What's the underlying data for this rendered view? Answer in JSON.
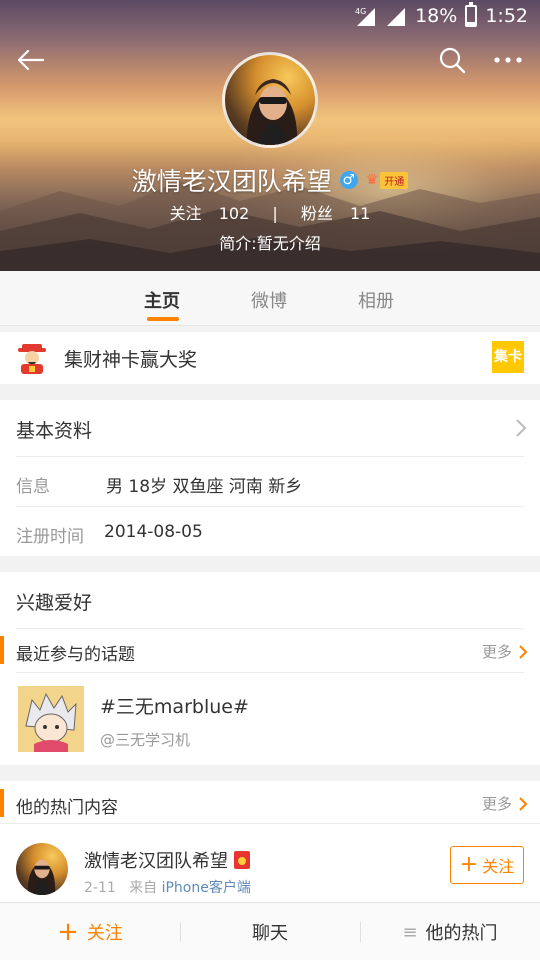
{
  "status_bar": {
    "network": "4G",
    "battery_percent": "18%",
    "battery_level": 0.18,
    "time": "1:52"
  },
  "header": {
    "back_icon": "arrow-left-icon",
    "search_icon": "search-icon",
    "more_icon": "more-horizontal-icon",
    "name": "激情老汉团队希望",
    "gender_symbol": "♂",
    "vip_label": "开通",
    "following_label": "关注",
    "following_count": "102",
    "separator": "|",
    "followers_label": "粉丝",
    "followers_count": "11",
    "bio": "简介:暂无介绍"
  },
  "tabs": [
    {
      "label": "主页",
      "active": true
    },
    {
      "label": "微博",
      "active": false
    },
    {
      "label": "相册",
      "active": false
    }
  ],
  "treasure": {
    "title": "集财神卡赢大奖",
    "badge": "集卡"
  },
  "basic_info": {
    "title": "基本资料",
    "info_label": "信息",
    "info_value": "男 18岁 双鱼座 河南 新乡",
    "reg_label": "注册时间",
    "reg_value": "2014-08-05"
  },
  "interests": {
    "title": "兴趣爱好",
    "recent_topics_title": "最近参与的话题",
    "more": "更多",
    "topic_title": "#三无marblue#",
    "topic_sub": "@三无学习机"
  },
  "hot": {
    "title": "他的热门内容",
    "more": "更多",
    "post_name": "激情老汉团队希望",
    "post_date": "2-11",
    "post_from": "来自",
    "post_source": "iPhone客户端",
    "follow_label": "关注",
    "follow_plus": "+"
  },
  "bottom_bar": {
    "follow_plus": "+",
    "follow": "关注",
    "chat": "聊天",
    "hot_icon": "≡",
    "hot": "他的热门"
  },
  "colors": {
    "accent": "#ff8200",
    "link": "#5f8ab7",
    "gender": "#3fa7f0"
  }
}
